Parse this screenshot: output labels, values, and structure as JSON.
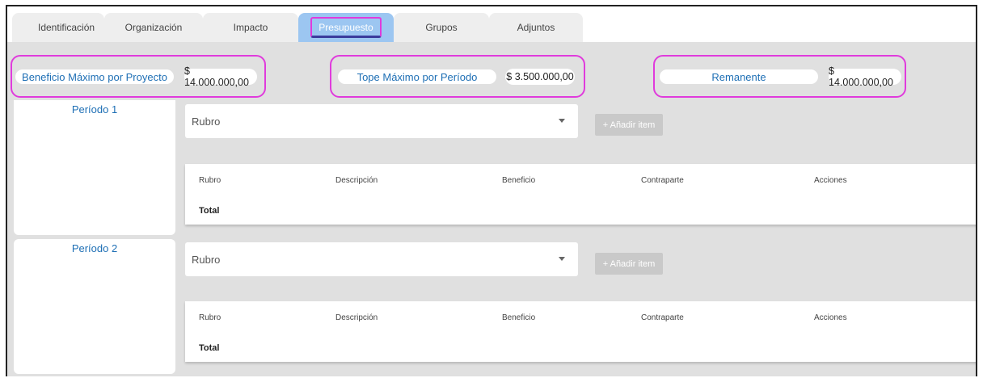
{
  "tabs": [
    {
      "label": "Identificación"
    },
    {
      "label": "Organización"
    },
    {
      "label": "Impacto"
    },
    {
      "label": "Presupuesto"
    },
    {
      "label": "Grupos"
    },
    {
      "label": "Adjuntos"
    }
  ],
  "summary": {
    "max_project_label": "Beneficio Máximo por Proyecto",
    "max_project_value": "$ 14.000.000,00",
    "max_period_label": "Tope Máximo por Período",
    "max_period_value": "$ 3.500.000,00",
    "remaining_label": "Remanente",
    "remaining_value": "$ 14.000.000,00"
  },
  "periods": [
    {
      "title": "Período 1",
      "select_placeholder": "Rubro",
      "add_label": "+ Añadir item",
      "columns": [
        "Rubro",
        "Descripción",
        "Beneficio",
        "Contraparte",
        "Acciones"
      ],
      "total_label": "Total"
    },
    {
      "title": "Período 2",
      "select_placeholder": "Rubro",
      "add_label": "+ Añadir item",
      "columns": [
        "Rubro",
        "Descripción",
        "Beneficio",
        "Contraparte",
        "Acciones"
      ],
      "total_label": "Total"
    }
  ],
  "colors": {
    "accent_blue": "#1e6fb5",
    "active_tab": "#9cc6f1",
    "highlight_magenta": "#e03bdc"
  }
}
